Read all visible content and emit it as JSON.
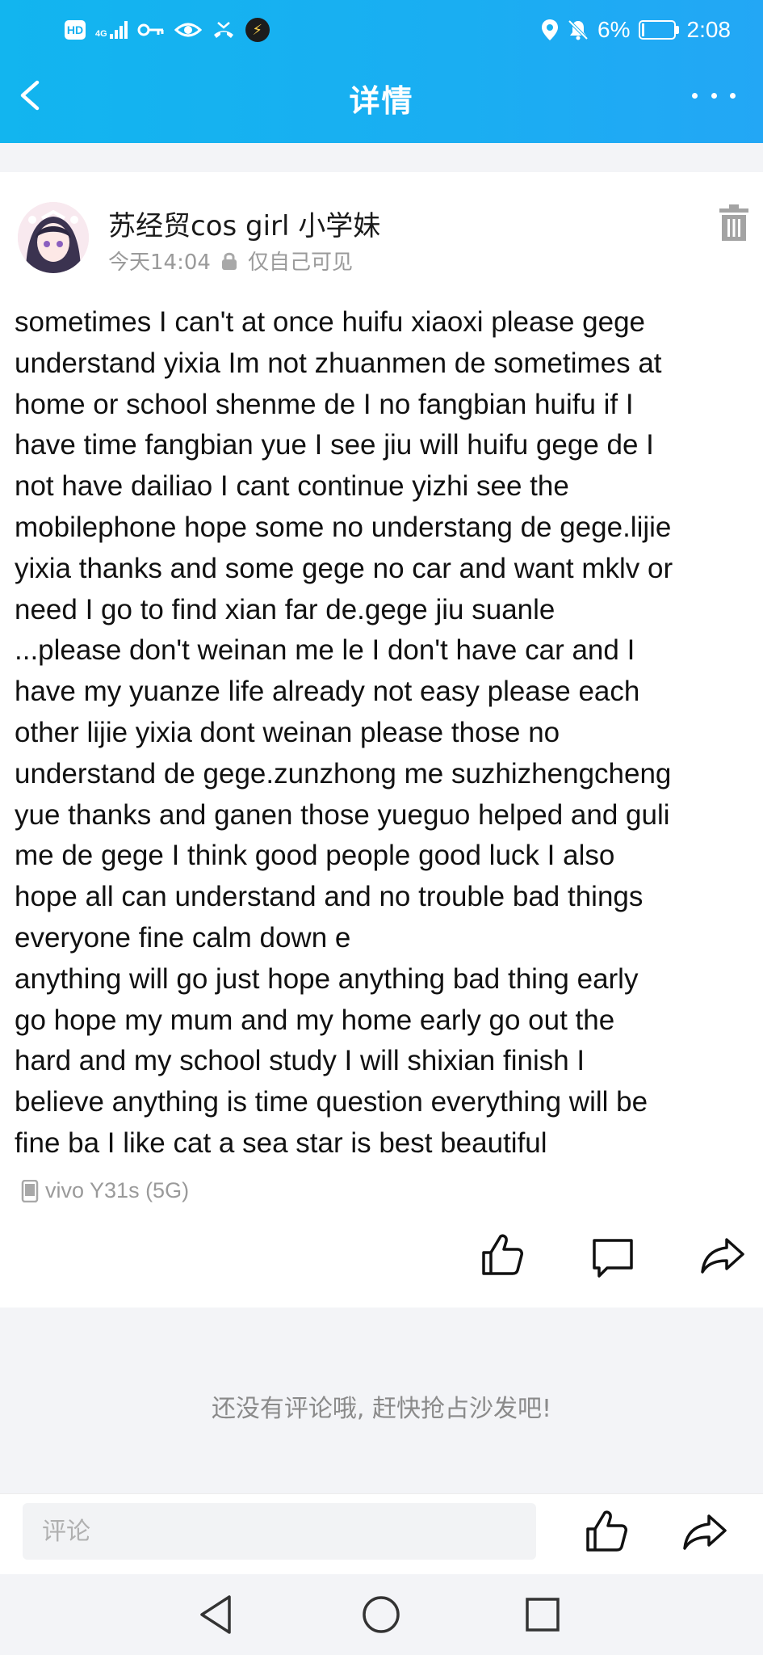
{
  "status_bar": {
    "hd_label": "HD",
    "network_label": "4G",
    "battery_percent": "6%",
    "time": "2:08"
  },
  "header": {
    "title": "详情"
  },
  "post": {
    "username": "苏经贸cos girl 小学妹",
    "time": "今天14:04",
    "visibility": "仅自己可见",
    "body": "sometimes I can't at once huifu xiaoxi please gege\nunderstand  yixia Im not zhuanmen de sometimes at\nhome or school shenme de I no fangbian huifu if I\nhave time fangbian yue I see jiu will huifu gege de I\nnot have dailiao  I cant continue yizhi see the\nmobilephone hope some no understang de gege.lijie\nyixia thanks and some gege no car and want mklv or\n need I go to find  xian far de.gege  jiu suanle\n...please don't weinan me le I don't have car and I\nhave my yuanze life already not easy please each\nother lijie yixia dont weinan please those no\nunderstand de gege.zunzhong me suzhizhengcheng\nyue thanks and ganen those yueguo helped and guli\nme de gege I think good people good luck I also\nhope all can understand and no trouble bad things\neveryone fine calm down e\nanything will go just hope anything bad thing early\ngo hope my mum and my home early go out the\nhard and my school study I will shixian finish I\nbelieve anything is time question everything will be\nfine ba I like cat a sea star is best beautiful",
    "device": "vivo Y31s (5G)"
  },
  "comments": {
    "empty_text": "还没有评论哦, 赶快抢占沙发吧!"
  },
  "comment_bar": {
    "placeholder": "评论"
  },
  "icons": {
    "back": "chevron-left-icon",
    "more": "more-dots-icon",
    "delete": "trash-icon",
    "like": "thumbs-up-icon",
    "comment": "comment-icon",
    "share": "share-icon"
  },
  "colors": {
    "header_blue": "#1aaef2",
    "secondary_text": "#9a9a9a",
    "background_grey": "#f3f4f7"
  }
}
